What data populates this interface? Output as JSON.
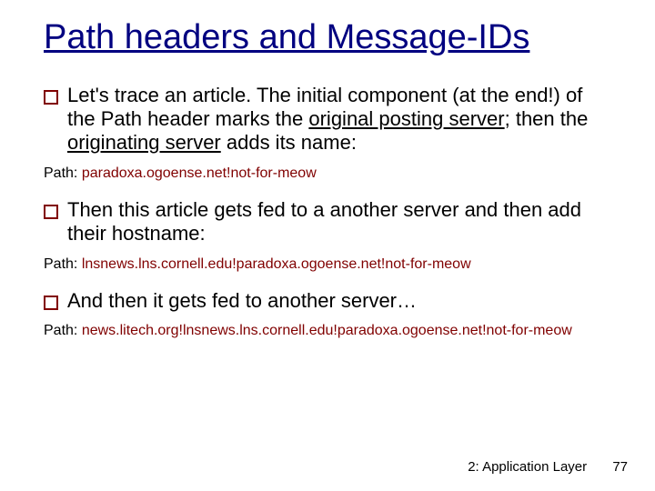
{
  "title": "Path headers and Message-IDs",
  "bullets": {
    "b1": {
      "pre": "Let's trace an article.  The initial component (at the end!) of the Path header marks the ",
      "u1": "original posting server",
      "mid": "; then the ",
      "u2": "originating server",
      "post": " adds its name:"
    },
    "b2": "Then this article gets fed to a another server and then add their hostname:",
    "b3": "And then it gets fed to another server…"
  },
  "paths": {
    "label": "Path: ",
    "p1": "paradoxa.ogoense.net!not-for-meow",
    "p2": "lnsnews.lns.cornell.edu!paradoxa.ogoense.net!not-for-meow",
    "p3": "news.litech.org!lnsnews.lns.cornell.edu!paradoxa.ogoense.net!not-for-meow"
  },
  "footer": {
    "section": "2: Application Layer",
    "page": "77"
  }
}
